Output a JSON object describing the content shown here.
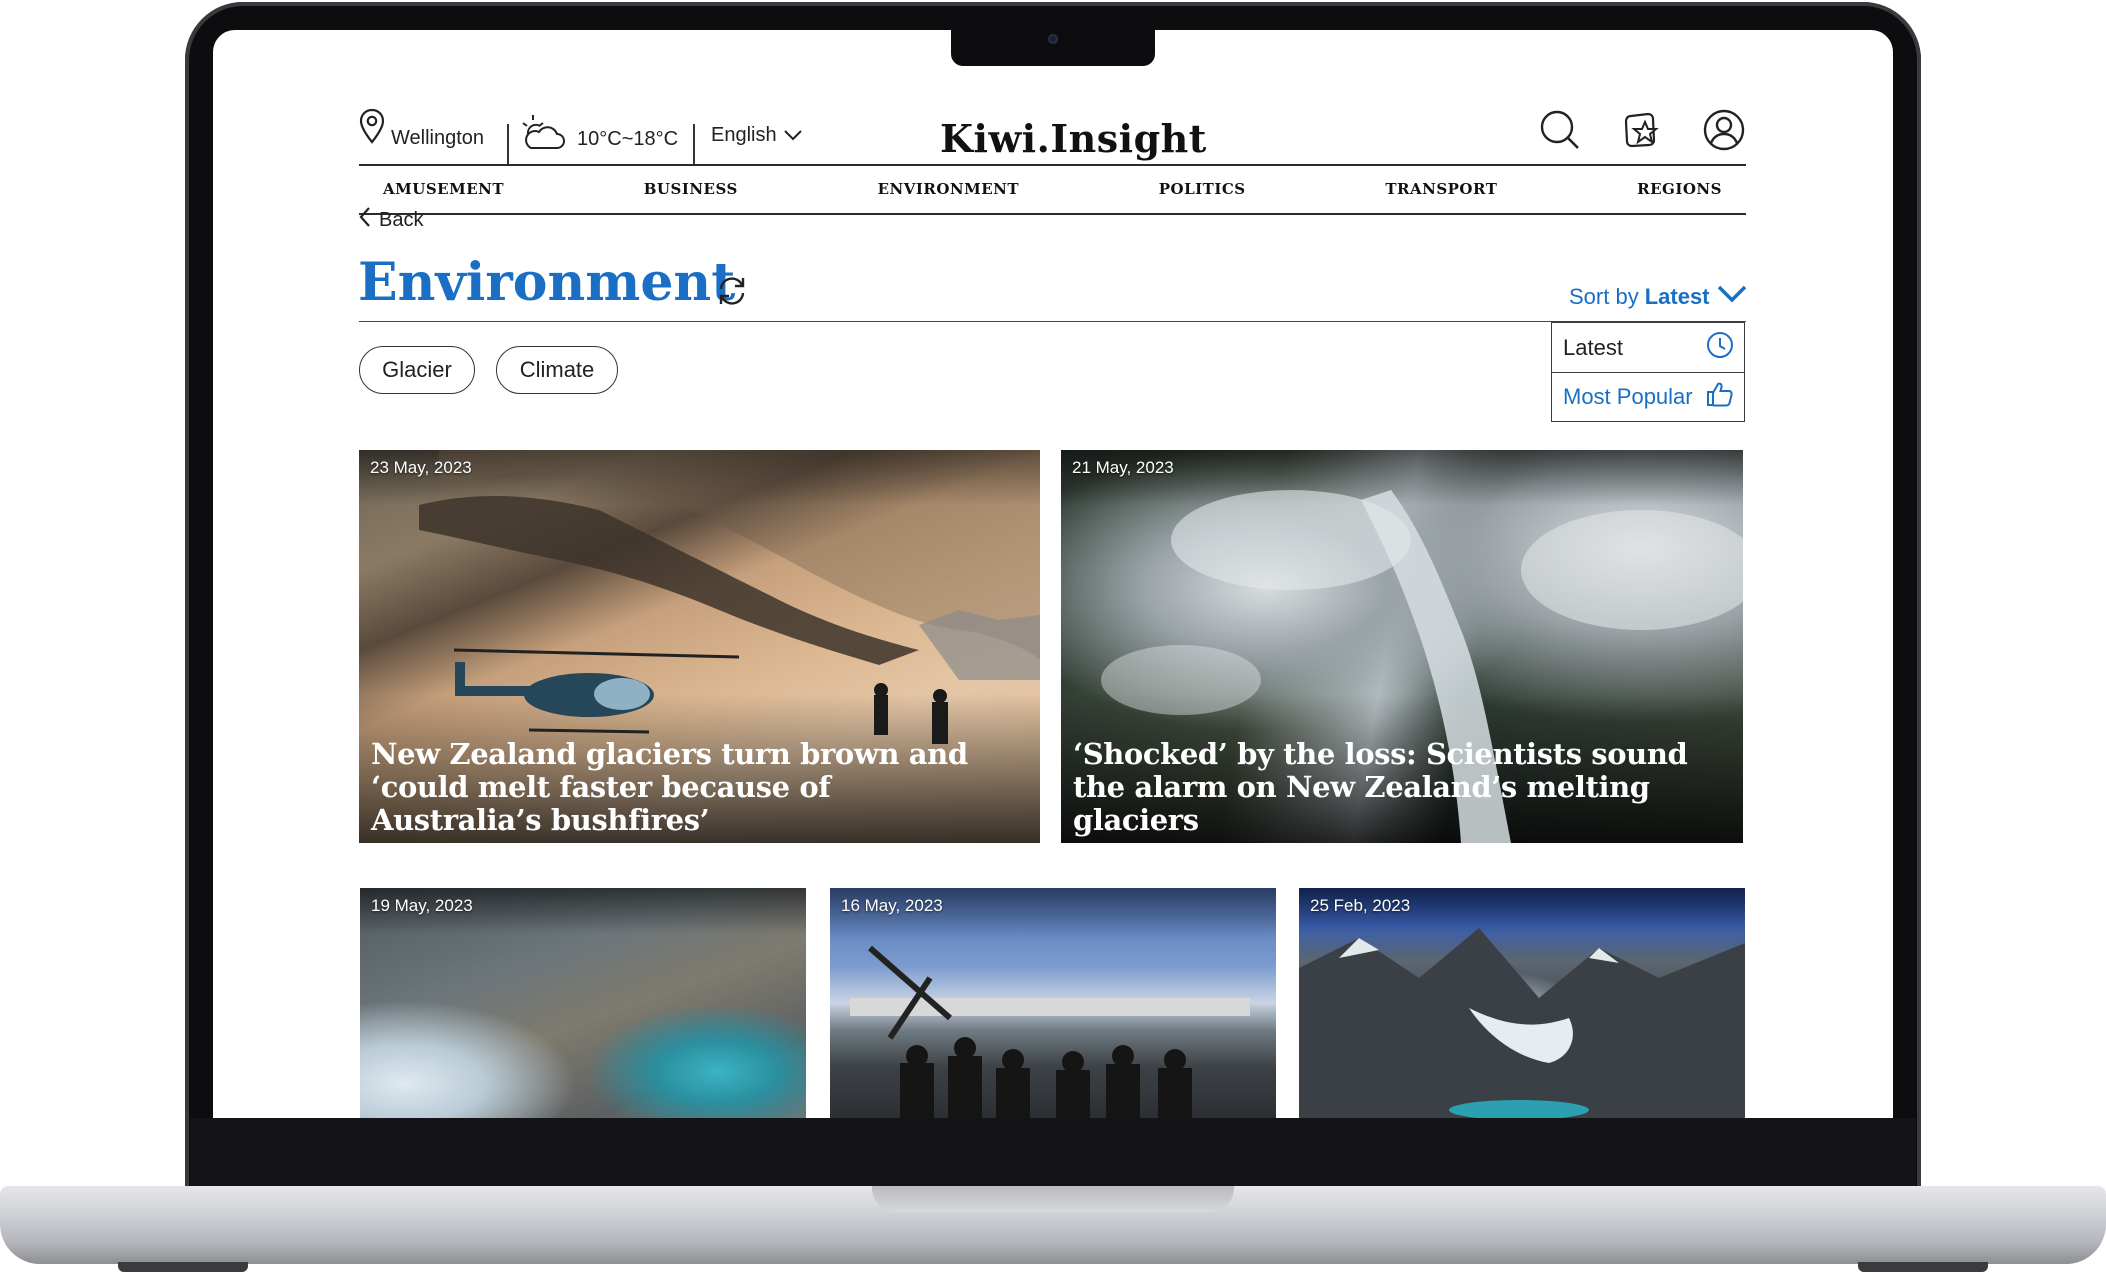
{
  "header": {
    "location": "Wellington",
    "temperature": "10°C~18°C",
    "language": "English",
    "brand": "Kiwi.Insight"
  },
  "nav": [
    "AMUSEMENT",
    "BUSINESS",
    "ENVIRONMENT",
    "POLITICS",
    "TRANSPORT",
    "REGIONS"
  ],
  "back_label": "Back",
  "page_title": "Environment",
  "sort": {
    "prefix": "Sort by",
    "value": "Latest"
  },
  "sort_options": [
    "Latest",
    "Most Popular"
  ],
  "tags": [
    "Glacier",
    "Climate"
  ],
  "articles": [
    {
      "date": "23 May, 2023",
      "headline": "New Zealand glaciers turn brown and ‘could melt faster because of Australia’s bushfires’"
    },
    {
      "date": "21 May, 2023",
      "headline": "‘Shocked’ by the loss: Scientists sound the alarm on New Zealand’s melting glaciers"
    },
    {
      "date": "19 May, 2023",
      "headline": ""
    },
    {
      "date": "16 May, 2023",
      "headline": ""
    },
    {
      "date": "25 Feb, 2023",
      "headline": ""
    }
  ],
  "colors": {
    "accent": "#1a6fc4",
    "text": "#222222"
  },
  "icons": [
    "location-pin-icon",
    "cloud-sun-icon",
    "chevron-down-icon",
    "search-icon",
    "bookmark-star-icon",
    "user-icon",
    "chevron-left-icon",
    "refresh-icon",
    "clock-icon",
    "thumbs-up-icon"
  ]
}
